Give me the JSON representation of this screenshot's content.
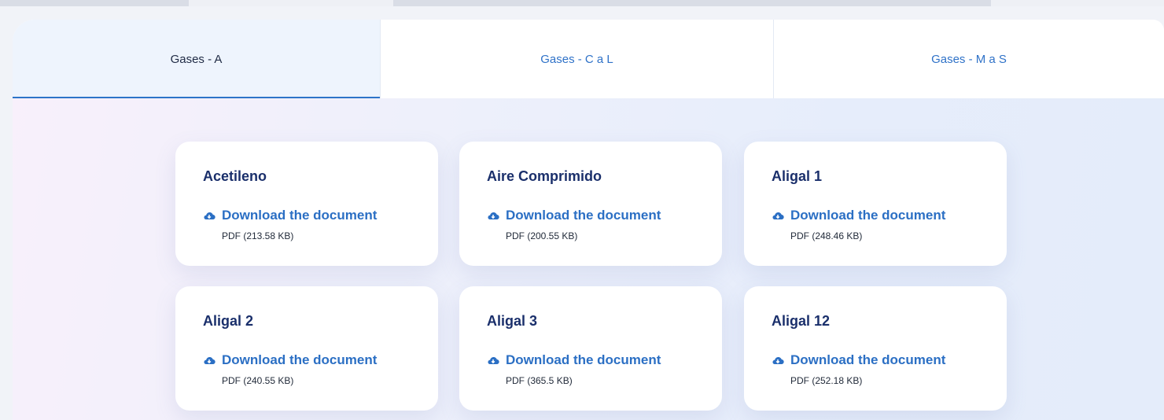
{
  "tabs": [
    {
      "label": "Gases - A",
      "active": true
    },
    {
      "label": "Gases - C a L",
      "active": false
    },
    {
      "label": "Gases - M a S",
      "active": false
    }
  ],
  "download_label": "Download the document",
  "download_icon": "cloud-download-icon",
  "documents": [
    {
      "title": "Acetileno",
      "meta": "PDF (213.58 KB)"
    },
    {
      "title": "Aire Comprimido",
      "meta": "PDF (200.55 KB)"
    },
    {
      "title": "Aligal 1",
      "meta": "PDF (248.46 KB)"
    },
    {
      "title": "Aligal 2",
      "meta": "PDF (240.55 KB)"
    },
    {
      "title": "Aligal 3",
      "meta": "PDF (365.5 KB)"
    },
    {
      "title": "Aligal 12",
      "meta": "PDF (252.18 KB)"
    }
  ],
  "colors": {
    "accent": "#2d74c9",
    "title": "#1a2f6b",
    "active_tab_bg": "#eef4fd"
  }
}
